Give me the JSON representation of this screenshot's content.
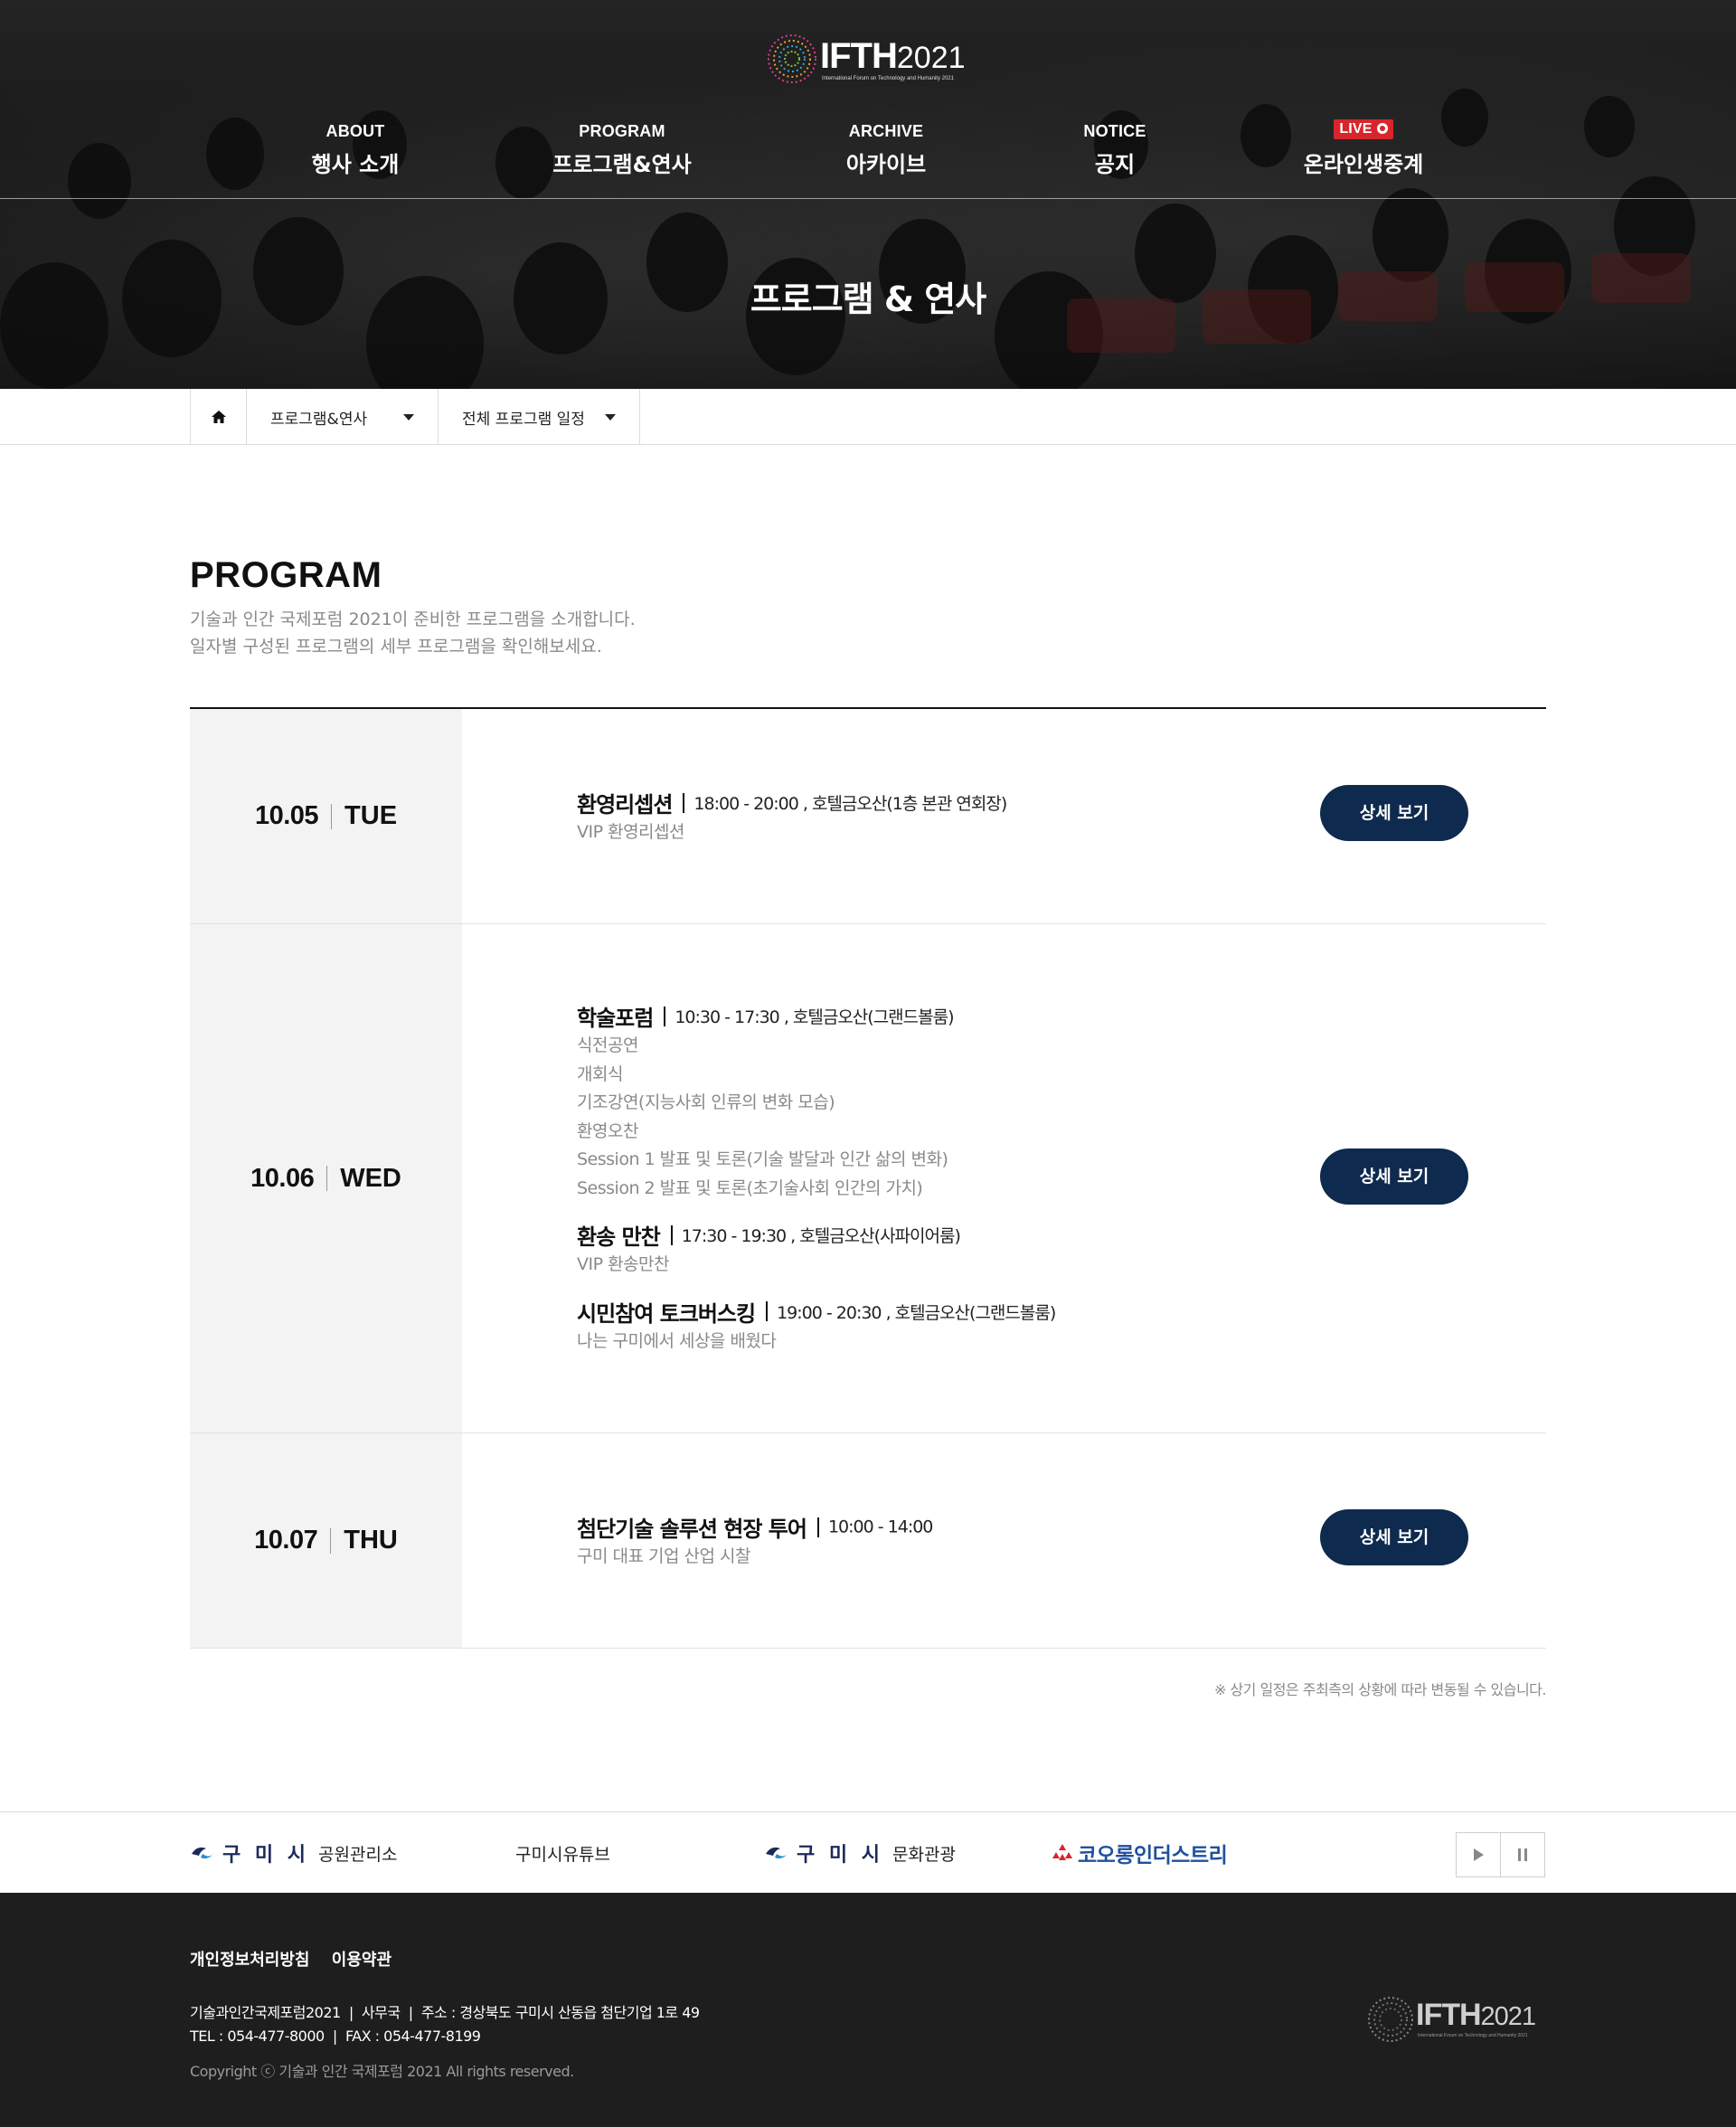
{
  "logo": {
    "text_main": "IFTH",
    "text_year": "2021",
    "subtitle": "International Forum on Technology and Humanity 2021"
  },
  "nav": [
    {
      "en": "ABOUT",
      "ko": "행사 소개"
    },
    {
      "en": "PROGRAM",
      "ko": "프로그램&연사"
    },
    {
      "en": "ARCHIVE",
      "ko": "아카이브"
    },
    {
      "en": "NOTICE",
      "ko": "공지"
    },
    {
      "en": "LIVE",
      "ko": "온라인생중계"
    }
  ],
  "hero": {
    "title": "프로그램 & 연사"
  },
  "breadcrumb": {
    "home_icon": "home-icon",
    "level1": "프로그램&연사",
    "level2": "전체 프로그램 일정"
  },
  "program": {
    "title": "PROGRAM",
    "desc_line1": "기술과 인간 국제포럼 2021이 준비한 프로그램을 소개합니다.",
    "desc_line2": "일자별 구성된 프로그램의 세부 프로그램을 확인해보세요.",
    "button_label": "상세 보기",
    "days": [
      {
        "date": "10.05",
        "day": "TUE",
        "items": [
          {
            "title": "환영리셉션",
            "meta": "18:00 - 20:00 , 호텔금오산(1층 본관 연회장)",
            "subs": [
              "VIP 환영리셉션"
            ]
          }
        ]
      },
      {
        "date": "10.06",
        "day": "WED",
        "items": [
          {
            "title": "학술포럼",
            "meta": "10:30 - 17:30 , 호텔금오산(그랜드볼룸)",
            "subs": [
              "식전공연",
              "개회식",
              "기조강연(지능사회 인류의 변화 모습)",
              "환영오찬",
              "Session 1 발표 및 토론(기술 발달과 인간 삶의 변화)",
              "Session 2 발표 및 토론(초기술사회 인간의 가치)"
            ]
          },
          {
            "title": "환송 만찬",
            "meta": "17:30 - 19:30 , 호텔금오산(사파이어룸)",
            "subs": [
              "VIP 환송만찬"
            ]
          },
          {
            "title": "시민참여 토크버스킹",
            "meta": "19:00 - 20:30 , 호텔금오산(그랜드볼룸)",
            "subs": [
              "나는 구미에서 세상을 배웠다"
            ]
          }
        ]
      },
      {
        "date": "10.07",
        "day": "THU",
        "items": [
          {
            "title": "첨단기술 솔루션 현장 투어",
            "meta": "10:00 - 14:00",
            "subs": [
              "구미 대표 기업 산업 시찰"
            ]
          }
        ]
      }
    ],
    "note": "※ 상기 일정은 주최측의 상황에 따라 변동될 수 있습니다."
  },
  "partners": [
    {
      "strong": "구 미 시",
      "label": "공원관리소",
      "icon": "gumi-logo-icon"
    },
    {
      "strong": "",
      "label": "구미시유튜브",
      "icon": ""
    },
    {
      "strong": "구 미 시",
      "label": "문화관광",
      "icon": "gumi-logo-icon"
    },
    {
      "strong": "코오롱인더스트리",
      "label": "",
      "icon": "kolon-logo-icon"
    }
  ],
  "footer": {
    "privacy": "개인정보처리방침",
    "terms": "이용약관",
    "info_line1": "기술과인간국제포럼2021  |  사무국  |  주소 : 경상북도 구미시 산동읍 첨단기업 1로 49",
    "info_line2": "TEL : 054-477-8000  |  FAX : 054-477-8199",
    "copyright": "Copyright ⓒ 기술과 인간 국제포럼 2021 All rights reserved.",
    "logo_main": "IFTH",
    "logo_year": "2021",
    "logo_sub": "International Forum on Technology and Humanity 2021"
  },
  "colors": {
    "button_navy": "#0e2a4e",
    "live_red": "#d7262b",
    "footer_bg": "#1e1e1e",
    "date_cell_bg": "#f3f3f3"
  }
}
